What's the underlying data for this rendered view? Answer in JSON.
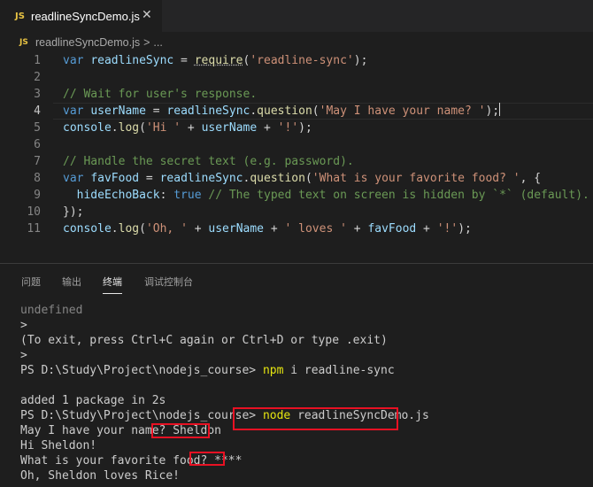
{
  "tab": {
    "icon_label": "JS",
    "title": "readlineSyncDemo.js",
    "close": "✕"
  },
  "breadcrumb": {
    "icon_label": "JS",
    "file": "readlineSyncDemo.js",
    "separator": ">",
    "more": "..."
  },
  "editor": {
    "current_line": 4,
    "lines": [
      {
        "n": "1",
        "text": "var readlineSync = require('readline-sync');"
      },
      {
        "n": "2",
        "text": ""
      },
      {
        "n": "3",
        "text": "// Wait for user's response."
      },
      {
        "n": "4",
        "text": "var userName = readlineSync.question('May I have your name? ');"
      },
      {
        "n": "5",
        "text": "console.log('Hi ' + userName + '!');"
      },
      {
        "n": "6",
        "text": ""
      },
      {
        "n": "7",
        "text": "// Handle the secret text (e.g. password)."
      },
      {
        "n": "8",
        "text": "var favFood = readlineSync.question('What is your favorite food? ', {"
      },
      {
        "n": "9",
        "text": "  hideEchoBack: true // The typed text on screen is hidden by `*` (default)."
      },
      {
        "n": "10",
        "text": "});"
      },
      {
        "n": "11",
        "text": "console.log('Oh, ' + userName + ' loves ' + favFood + '!');"
      }
    ]
  },
  "panel": {
    "tabs": [
      "问题",
      "输出",
      "终端",
      "调试控制台"
    ],
    "active_tab": "终端"
  },
  "terminal": {
    "lines": [
      "undefined",
      ">",
      "(To exit, press Ctrl+C again or Ctrl+D or type .exit)",
      ">",
      "PS D:\\Study\\Project\\nodejs_course> ",
      "",
      "added 1 package in 2s",
      "PS D:\\Study\\Project\\nodejs_course> ",
      "May I have your name? ",
      "Hi Sheldon!",
      "What is your favorite food? ",
      "Oh, Sheldon loves Rice!"
    ],
    "cmd1_name": "npm",
    "cmd1_args": " i readline-sync",
    "cmd2_name": "node",
    "cmd2_args": " readlineSyncDemo.js",
    "answer_name": "Sheldon",
    "answer_food": "****"
  }
}
